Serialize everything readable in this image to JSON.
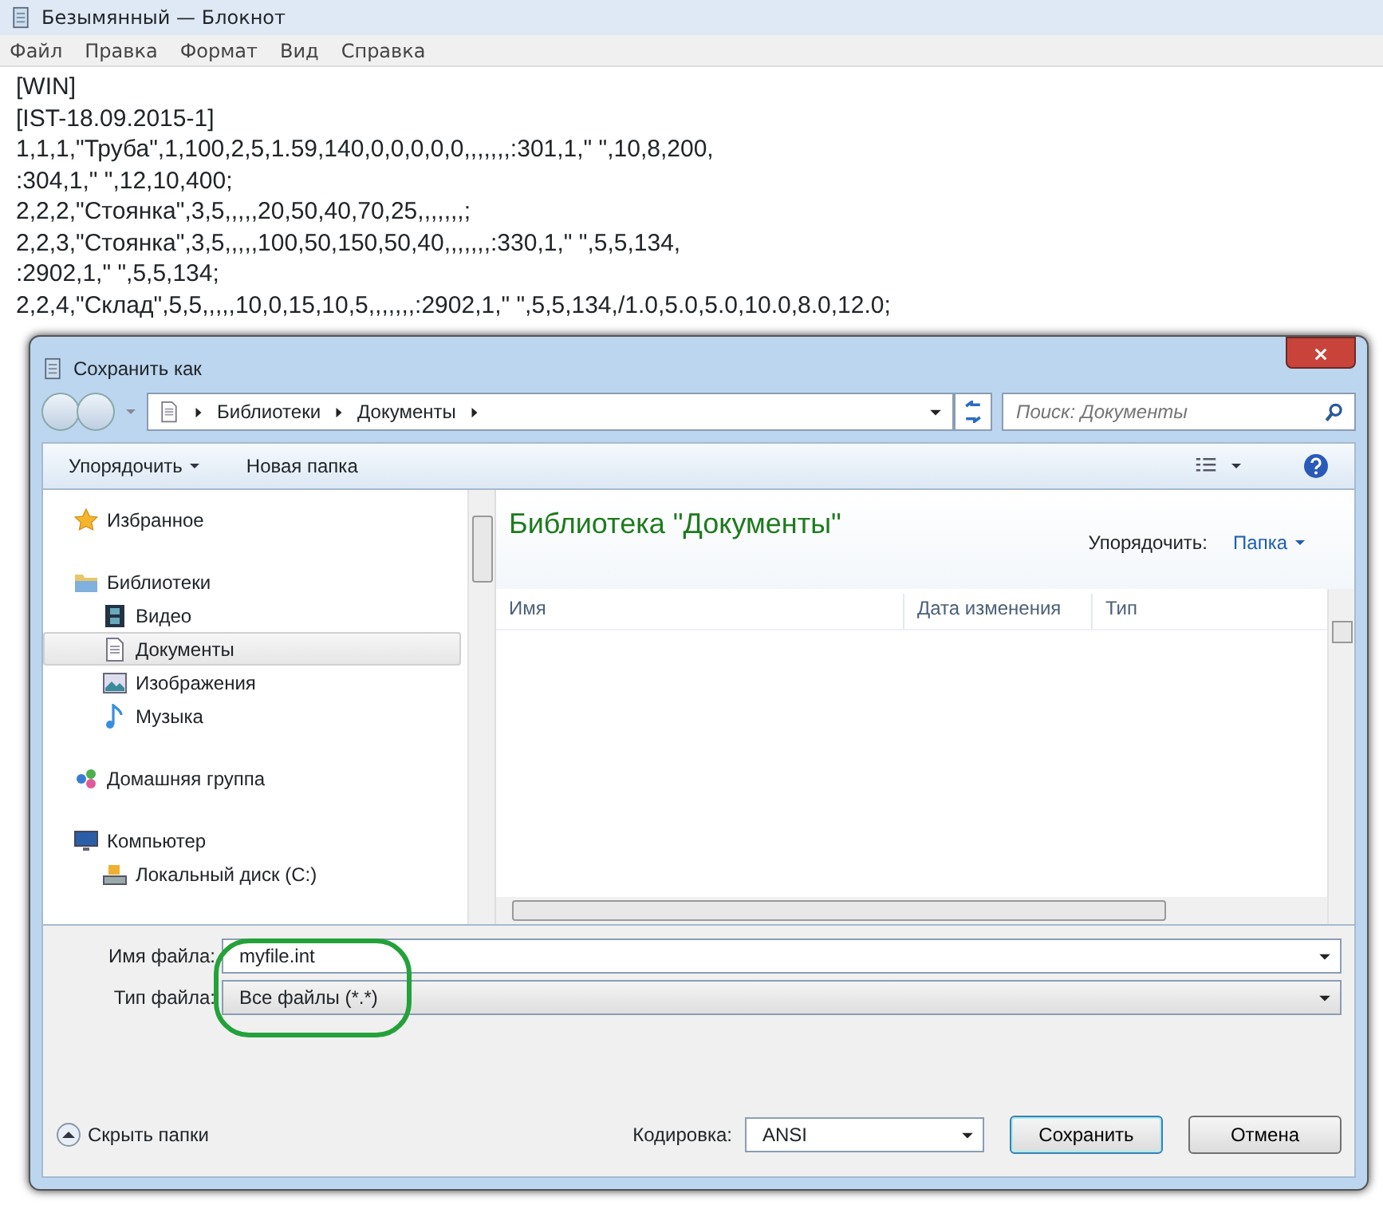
{
  "notepad": {
    "title": "Безымянный — Блокнот",
    "menu": [
      "Файл",
      "Правка",
      "Формат",
      "Вид",
      "Справка"
    ],
    "lines": [
      "[WIN]",
      "[IST-18.09.2015-1]",
      "1,1,1,\"Труба\",1,100,2,5,1.59,140,0,0,0,0,0,,,,,,,:301,1,\" \",10,8,200,",
      ":304,1,\" \",12,10,400;",
      "2,2,2,\"Стоянка\",3,5,,,,,20,50,40,70,25,,,,,,,;",
      "2,2,3,\"Стоянка\",3,5,,,,,100,50,150,50,40,,,,,,,:330,1,\" \",5,5,134,",
      ":2902,1,\" \",5,5,134;",
      "2,2,4,\"Склад\",5,5,,,,,10,0,15,10,5,,,,,,,:2902,1,\" \",5,5,134,/1.0,5.0,5.0,10.0,8.0,12.0;"
    ]
  },
  "dialog": {
    "title": "Сохранить как",
    "breadcrumb": [
      "Библиотеки",
      "Документы"
    ],
    "search": {
      "placeholder": "Поиск: Документы"
    },
    "toolbar": {
      "organize": "Упорядочить",
      "new_folder": "Новая папка"
    },
    "nav": [
      {
        "label": "Избранное",
        "kind": "favorites",
        "selected": false
      },
      {
        "label": "Библиотеки",
        "kind": "libraries",
        "selected": false,
        "children": [
          {
            "label": "Видео",
            "kind": "video",
            "selected": false
          },
          {
            "label": "Документы",
            "kind": "documents",
            "selected": true
          },
          {
            "label": "Изображения",
            "kind": "pictures",
            "selected": false
          },
          {
            "label": "Музыка",
            "kind": "music",
            "selected": false
          }
        ]
      },
      {
        "label": "Домашняя группа",
        "kind": "homegroup",
        "selected": false
      },
      {
        "label": "Компьютер",
        "kind": "computer",
        "selected": false,
        "children": [
          {
            "label": "Локальный диск (C:)",
            "kind": "drive",
            "selected": false
          }
        ]
      }
    ],
    "library_title": "Библиотека \"Документы\"",
    "arrange_label": "Упорядочить:",
    "arrange_value": "Папка",
    "columns": [
      "Имя",
      "Дата изменения",
      "Тип"
    ],
    "filename_label": "Имя файла:",
    "filename": "myfile.int",
    "filetype_label": "Тип файла:",
    "filetype": "Все файлы  (*.*)",
    "hide_folders": "Скрыть папки",
    "encoding_label": "Кодировка:",
    "encoding": "ANSI",
    "buttons": [
      "Сохранить",
      "Отмена"
    ]
  }
}
